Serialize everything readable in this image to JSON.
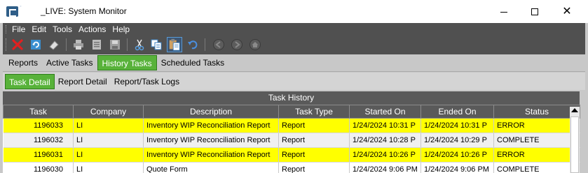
{
  "window": {
    "title": "_LIVE: System Monitor",
    "minimize_icon": "minimize-icon",
    "maximize_icon": "maximize-icon",
    "close_glyph": "✕"
  },
  "menu": [
    "File",
    "Edit",
    "Tools",
    "Actions",
    "Help"
  ],
  "toolbar_icons": [
    "delete-icon",
    "refresh-icon",
    "eraser-icon",
    "print-icon",
    "print-preview-icon",
    "save-icon",
    "cut-icon",
    "copy-icon",
    "paste-icon",
    "undo-icon",
    "back-icon",
    "forward-icon",
    "home-icon"
  ],
  "tabs": [
    "Reports",
    "Active Tasks",
    "History Tasks",
    "Scheduled Tasks"
  ],
  "active_tab": "History Tasks",
  "subtabs": [
    "Task Detail",
    "Report Detail",
    "Report/Task Logs"
  ],
  "active_subtab": "Task Detail",
  "grid": {
    "caption": "Task History",
    "columns": [
      "Task",
      "Company",
      "Description",
      "Task Type",
      "Started On",
      "Ended On",
      "Status"
    ],
    "rows": [
      {
        "task": "1196033",
        "company": "LI",
        "description": "Inventory WIP Reconciliation Report",
        "type": "Report",
        "started": "1/24/2024 10:31 P",
        "ended": "1/24/2024 10:31 P",
        "status": "ERROR"
      },
      {
        "task": "1196032",
        "company": "LI",
        "description": "Inventory WIP Reconciliation Report",
        "type": "Report",
        "started": "1/24/2024 10:28 P",
        "ended": "1/24/2024 10:29 P",
        "status": "COMPLETE"
      },
      {
        "task": "1196031",
        "company": "LI",
        "description": "Inventory WIP Reconciliation Report",
        "type": "Report",
        "started": "1/24/2024 10:26 P",
        "ended": "1/24/2024 10:26 P",
        "status": "ERROR"
      },
      {
        "task": "1196030",
        "company": "LI",
        "description": "Quote Form",
        "type": "Report",
        "started": "1/24/2024 9:06 PM",
        "ended": "1/24/2024 9:06 PM",
        "status": "COMPLETE"
      }
    ]
  },
  "colors": {
    "highlight": "#ffff00",
    "active_tab": "#58b23a",
    "menubar": "#505050",
    "grid_header": "#5a5a5a"
  }
}
